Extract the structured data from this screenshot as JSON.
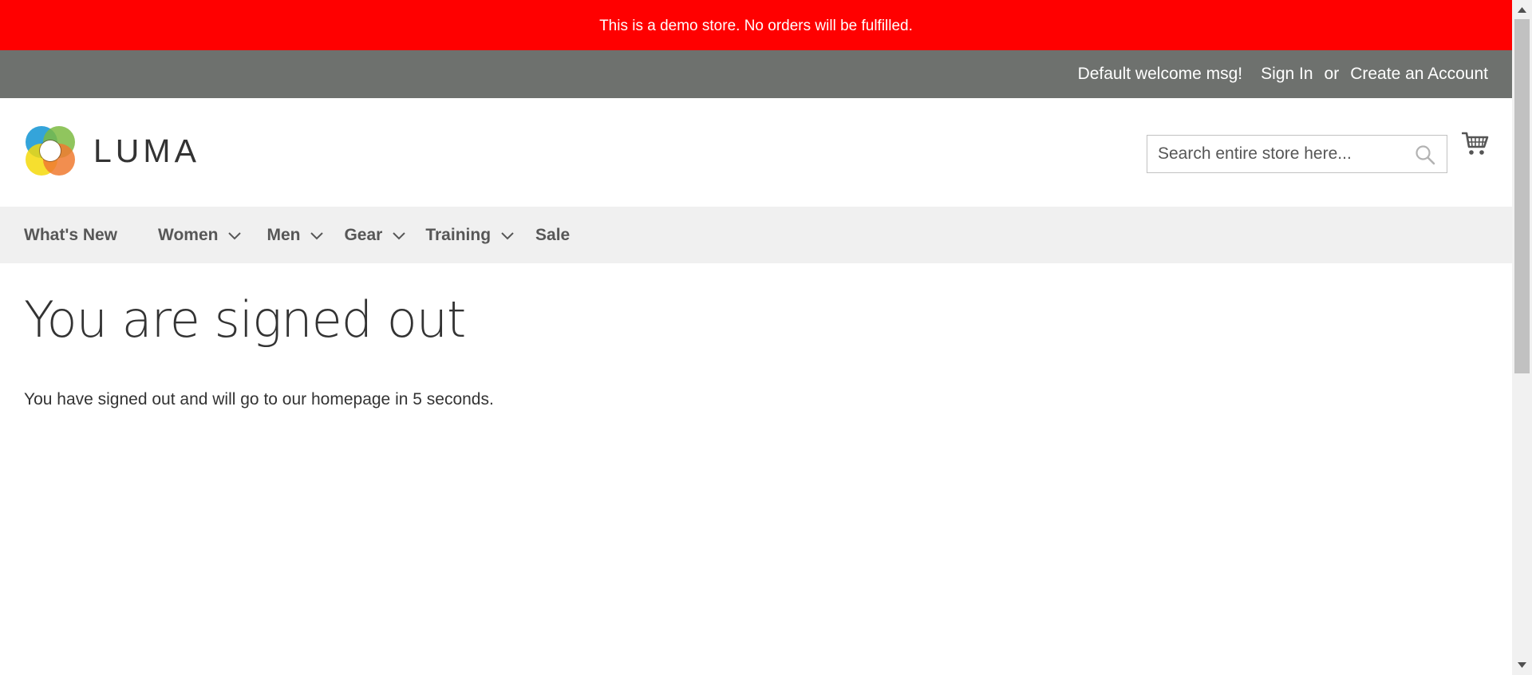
{
  "demo_notice": "This is a demo store. No orders will be fulfilled.",
  "panel": {
    "welcome": "Default welcome msg!",
    "sign_in": "Sign In",
    "or": "or",
    "create_account": "Create an Account"
  },
  "header": {
    "logo_text": "LUMA",
    "search_placeholder": "Search entire store here..."
  },
  "nav": {
    "items": [
      {
        "label": "What's New"
      },
      {
        "label": "Women"
      },
      {
        "label": "Men"
      },
      {
        "label": "Gear"
      },
      {
        "label": "Training"
      },
      {
        "label": "Sale"
      }
    ]
  },
  "main": {
    "title": "You are signed out",
    "message": "You have signed out and will go to our homepage in 5 seconds."
  },
  "colors": {
    "notice_bg": "#ff0000",
    "panel_bg": "#6e716e",
    "nav_bg": "#f0f0f0"
  }
}
